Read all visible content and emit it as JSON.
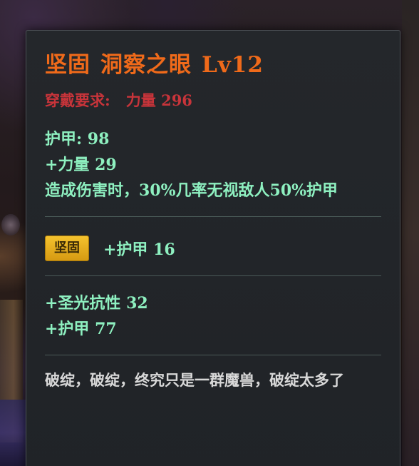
{
  "item": {
    "affix": "坚固",
    "name": "洞察之眼",
    "level": "Lv12"
  },
  "requirement": {
    "label": "穿戴要求:",
    "value": "力量 296"
  },
  "base_stats": [
    "护甲: 98",
    "+力量 29",
    "造成伤害时，30%几率无视敌人50%护甲"
  ],
  "socket": {
    "gem_label": "坚固",
    "stat": "+护甲 16"
  },
  "bonus_stats": [
    "+圣光抗性 32",
    "+护甲 77"
  ],
  "flavor_text": "破绽，破绽，终究只是一群魔兽，破绽太多了",
  "colors": {
    "title": "#f06a1a",
    "requirement": "#c8343a",
    "stat": "#8ef0c0",
    "gem_badge": "#f4c22e",
    "flavor": "#d8d8d8"
  }
}
